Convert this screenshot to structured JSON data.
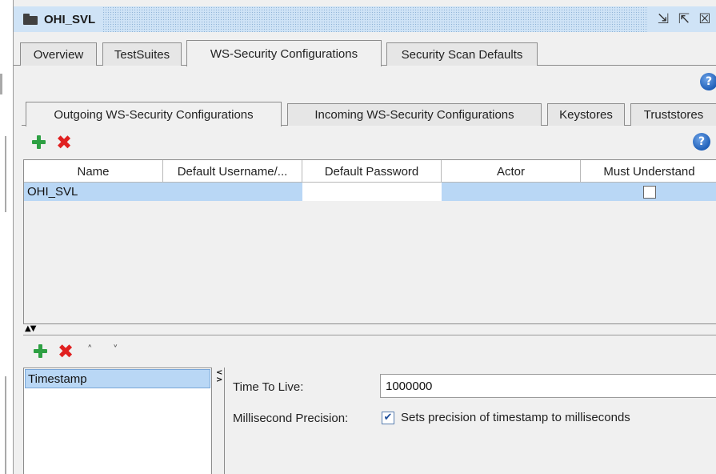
{
  "window": {
    "title": "OHI_SVL",
    "controls": {
      "restore": "⇲",
      "maximize": "⇱",
      "close": "☒"
    }
  },
  "main_tabs": [
    {
      "label": "Overview"
    },
    {
      "label": "TestSuites"
    },
    {
      "label": "WS-Security Configurations"
    },
    {
      "label": "Security Scan Defaults"
    }
  ],
  "active_main_tab": "WS-Security Configurations",
  "help_glyph": "?",
  "inner_tabs": [
    {
      "label": "Outgoing WS-Security Configurations"
    },
    {
      "label": "Incoming WS-Security Configurations"
    },
    {
      "label": "Keystores"
    },
    {
      "label": "Truststores"
    }
  ],
  "active_inner_tab": "Outgoing WS-Security Configurations",
  "toolbar": {
    "add": "add",
    "remove": "remove",
    "remove_glyph": "✖"
  },
  "table": {
    "columns": [
      "Name",
      "Default Username/...",
      "Default Password",
      "Actor",
      "Must Understand"
    ],
    "rows": [
      {
        "name": "OHI_SVL",
        "default_username": "",
        "default_password": "",
        "actor": "",
        "must_understand": false
      }
    ]
  },
  "splitter_glyph": "▲▼",
  "entries_toolbar": {
    "up_glyph": "˄",
    "down_glyph": "˅"
  },
  "entries": [
    {
      "label": "Timestamp",
      "selected": true
    }
  ],
  "collapse_glyph": "<\n>",
  "timestamp": {
    "time_to_live_label": "Time To Live:",
    "time_to_live_value": "1000000",
    "ms_precision_label": "Millisecond Precision:",
    "ms_precision_checked": true,
    "ms_precision_text": "Sets precision of timestamp to milliseconds",
    "check_glyph": "✔"
  }
}
